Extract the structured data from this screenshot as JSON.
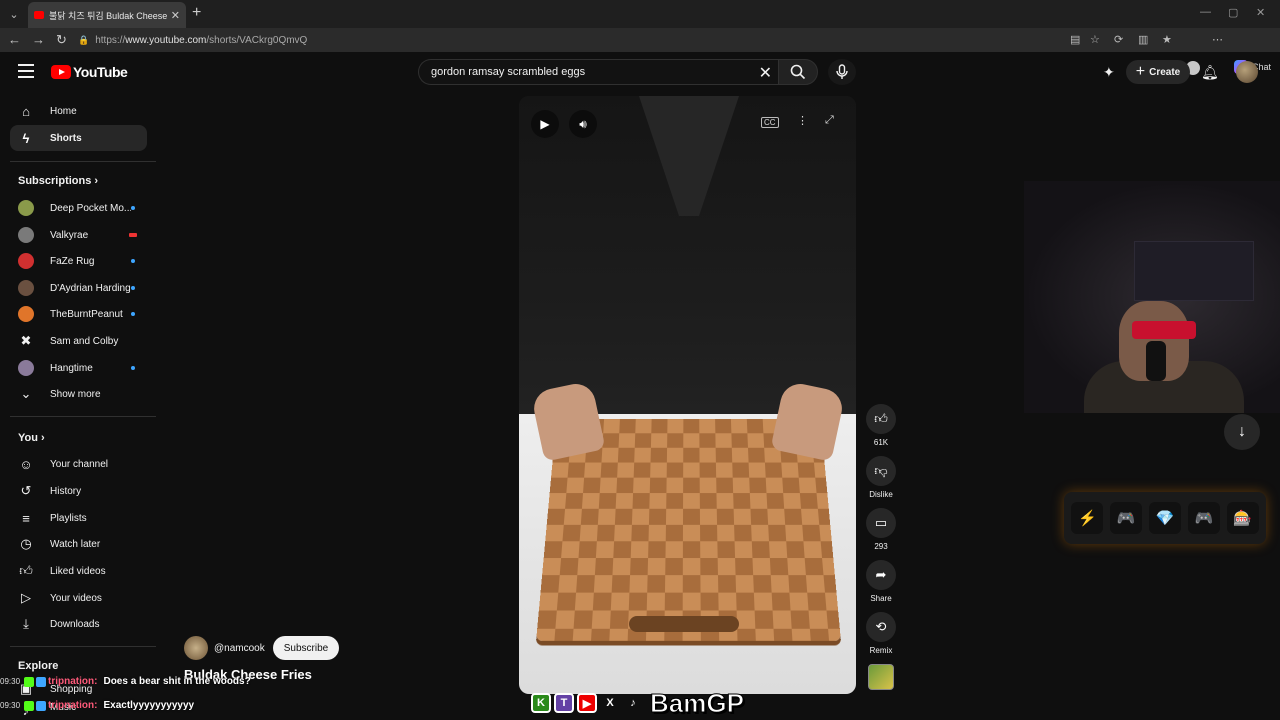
{
  "browser": {
    "tab_title": "불닭 치즈 튀김 Buldak Cheese Fries",
    "url_prefix": "https://",
    "url_domain": "www.youtube.com",
    "url_path": "/shorts/VACkrg0QmvQ",
    "copilot_label": "Chat"
  },
  "header": {
    "logo_text": "YouTube",
    "search_query": "gordon ramsay scrambled eggs",
    "create_label": "Create"
  },
  "sidebar": {
    "main": [
      {
        "label": "Home",
        "icon": "home-icon"
      },
      {
        "label": "Shorts",
        "icon": "shorts-icon"
      }
    ],
    "subscriptions_heading": "Subscriptions",
    "subscriptions": [
      {
        "label": "Deep Pocket Mo...",
        "indicator": "dot",
        "color": "#8a9a4a"
      },
      {
        "label": "Valkyrae",
        "indicator": "live",
        "color": "#7a7a7a"
      },
      {
        "label": "FaZe Rug",
        "indicator": "dot",
        "color": "#d03030"
      },
      {
        "label": "D'Aydrian Harding",
        "indicator": "dot",
        "color": "#6a5040"
      },
      {
        "label": "TheBurntPeanut",
        "indicator": "dot",
        "color": "#e0752a"
      },
      {
        "label": "Sam and Colby",
        "indicator": "none",
        "color": "#ffffff"
      },
      {
        "label": "Hangtime",
        "indicator": "dot",
        "color": "#8a7a9a"
      }
    ],
    "show_more_label": "Show more",
    "you_heading": "You",
    "you": [
      {
        "label": "Your channel",
        "icon": "channel-icon"
      },
      {
        "label": "History",
        "icon": "history-icon"
      },
      {
        "label": "Playlists",
        "icon": "playlists-icon"
      },
      {
        "label": "Watch later",
        "icon": "watch-later-icon"
      },
      {
        "label": "Liked videos",
        "icon": "liked-icon"
      },
      {
        "label": "Your videos",
        "icon": "your-videos-icon"
      },
      {
        "label": "Downloads",
        "icon": "downloads-icon"
      }
    ],
    "explore_heading": "Explore",
    "explore": [
      {
        "label": "Shopping"
      },
      {
        "label": "Music"
      }
    ]
  },
  "short": {
    "channel": "@namcook",
    "subscribe_label": "Subscribe",
    "title": "Buldak Cheese Fries",
    "actions": [
      {
        "icon": "like-icon",
        "label": "61K"
      },
      {
        "icon": "dislike-icon",
        "label": "Dislike"
      },
      {
        "icon": "comment-icon",
        "label": "293"
      },
      {
        "icon": "share-icon",
        "label": "Share"
      },
      {
        "icon": "remix-icon",
        "label": "Remix"
      }
    ]
  },
  "overlay": {
    "chat": [
      {
        "time": "09:30",
        "user": "tripnation:",
        "message": "Does a bear shit in the woods?"
      },
      {
        "time": "09:30",
        "user": "tripnation:",
        "message": "Exactlyyyyyyyyyyy"
      }
    ],
    "brand": "BamGP",
    "social_icons": [
      "K",
      "T",
      "▶",
      "X",
      "♪"
    ],
    "emotes": [
      "⚡",
      "🎮",
      "💎",
      "🎮",
      "🎰"
    ]
  }
}
